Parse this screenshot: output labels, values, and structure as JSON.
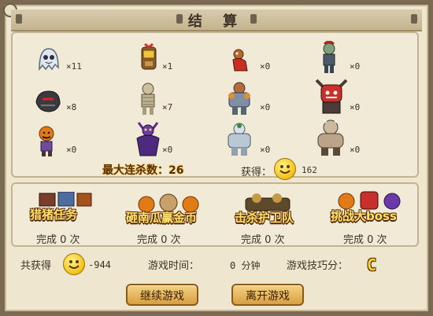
{
  "dialog": {
    "title": "结 算"
  },
  "kills": [
    {
      "count": "×11",
      "icon": "ghost-monster-icon"
    },
    {
      "count": "×1",
      "icon": "knight-monster-icon"
    },
    {
      "count": "×0",
      "icon": "imp-monster-icon"
    },
    {
      "count": "×0",
      "icon": "zombie-monster-icon"
    },
    {
      "count": "×8",
      "icon": "dark-beast-monster-icon"
    },
    {
      "count": "×7",
      "icon": "mummy-monster-icon"
    },
    {
      "count": "×0",
      "icon": "armored-brute-monster-icon"
    },
    {
      "count": "×0",
      "icon": "red-demon-monster-icon"
    },
    {
      "count": "×0",
      "icon": "pumpkin-monster-icon"
    },
    {
      "count": "×0",
      "icon": "purple-wraith-monster-icon"
    },
    {
      "count": "×0",
      "icon": "ice-golem-monster-icon"
    },
    {
      "count": "×0",
      "icon": "ogre-monster-icon"
    }
  ],
  "summary": {
    "streak_text": "最大连杀数：26",
    "earned_label": "获得：",
    "earned_value": "162"
  },
  "modes": [
    {
      "title": "猎猪任务",
      "done": "完成  0  次"
    },
    {
      "title": "砸南瓜赢金币",
      "done": "完成  0  次"
    },
    {
      "title": "击杀护卫队",
      "done": "完成  0  次"
    },
    {
      "title": "挑战大boss",
      "done": "完成  0  次"
    }
  ],
  "totals": {
    "total_label": "共获得",
    "total_value": "-944",
    "time_label": "游戏时间：",
    "time_value": "0 分钟",
    "skill_label": "游戏技巧分：",
    "skill_grade": "C"
  },
  "buttons": {
    "continue": "继续游戏",
    "leave": "离开游戏"
  }
}
